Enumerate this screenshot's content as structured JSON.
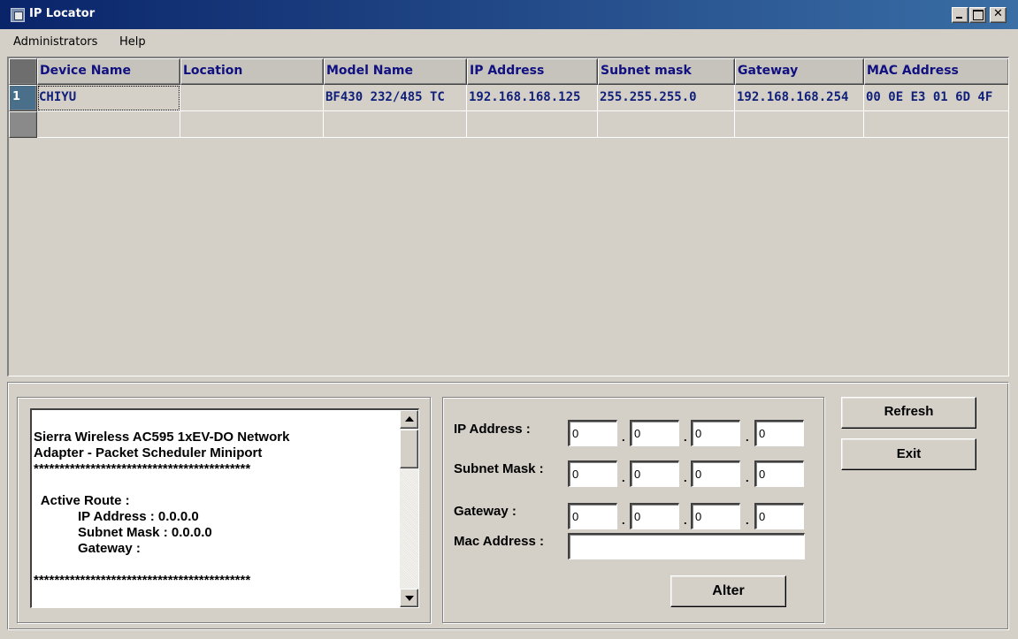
{
  "window": {
    "title": "IP Locator"
  },
  "menu": {
    "items": [
      {
        "label": "Administrators"
      },
      {
        "label": "Help"
      }
    ]
  },
  "grid": {
    "columns": [
      "Device Name",
      "Location",
      "Model Name",
      "IP Address",
      "Subnet mask",
      "Gateway",
      "MAC Address"
    ],
    "rows": [
      {
        "num": "1",
        "cells": [
          "CHIYU",
          "",
          "BF430 232/485 TC",
          "192.168.168.125",
          "255.255.255.0",
          "192.168.168.254",
          "00 0E E3 01 6D 4F"
        ]
      },
      {
        "num": "",
        "cells": [
          "",
          "",
          "",
          "",
          "",
          "",
          ""
        ]
      }
    ]
  },
  "info": {
    "text": "Sierra Wireless AC595 1xEV-DO Network\nAdapter - Packet Scheduler Miniport\n******************************************\n\n  Active Route :\n            IP Address : 0.0.0.0\n            Subnet Mask : 0.0.0.0\n            Gateway :\n\n******************************************"
  },
  "config": {
    "ip_label": "IP Address :",
    "mask_label": "Subnet Mask :",
    "gateway_label": "Gateway :",
    "mac_label": "Mac Address :",
    "ip": [
      "0",
      "0",
      "0",
      "0"
    ],
    "mask": [
      "0",
      "0",
      "0",
      "0"
    ],
    "gateway": [
      "0",
      "0",
      "0",
      "0"
    ],
    "mac": "",
    "dot": "."
  },
  "buttons": {
    "alter": "Alter",
    "refresh": "Refresh",
    "exit": "Exit"
  }
}
